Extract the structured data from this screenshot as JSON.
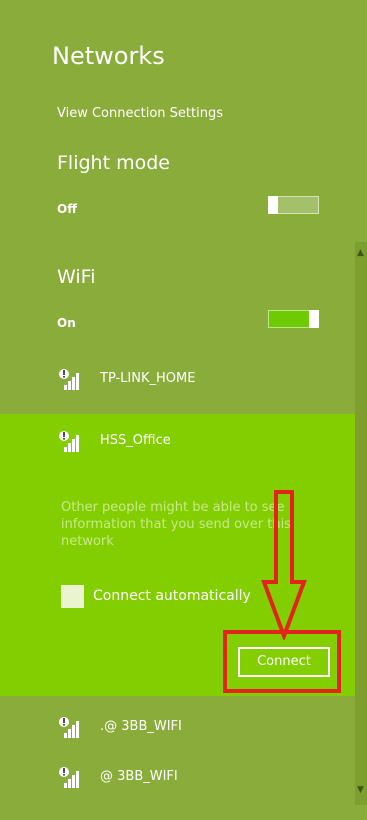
{
  "header": {
    "title": "Networks",
    "view_settings_label": "View Connection Settings"
  },
  "flight_mode": {
    "label": "Flight mode",
    "state": "Off"
  },
  "wifi": {
    "label": "WiFi",
    "state": "On"
  },
  "networks": [
    {
      "name": "TP-LINK_HOME",
      "icon": "wifi-signal-warning-icon"
    },
    {
      "name": "HSS_Office",
      "icon": "wifi-signal-warning-icon"
    },
    {
      "name": ".@ 3BB_WIFI",
      "icon": "wifi-signal-warning-icon"
    },
    {
      "name": "@ 3BB_WIFI",
      "icon": "wifi-signal-warning-icon"
    }
  ],
  "selected_network": {
    "warning": "Other people might be able to see information that you send over this network",
    "auto_connect_label": "Connect automatically",
    "connect_label": "Connect"
  },
  "colors": {
    "panel": "#8aac3b",
    "selected": "#83ce00",
    "toggle_on": "#6ecb00",
    "annotation": "#e1251b"
  }
}
